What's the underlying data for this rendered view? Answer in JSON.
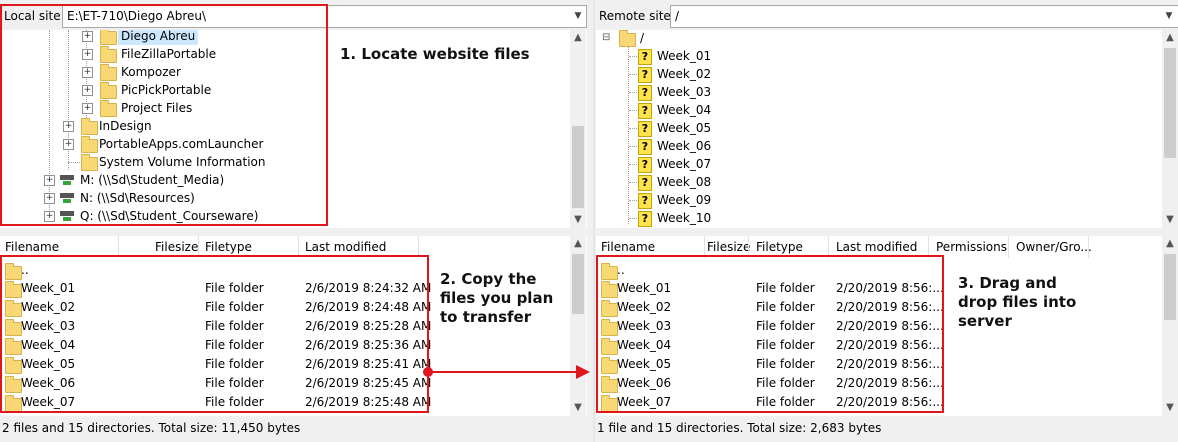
{
  "local": {
    "site_label": "Local site:",
    "path": "E:\\ET-710\\Diego Abreu\\",
    "tree": [
      {
        "label": "Diego Abreu",
        "selected": true
      },
      {
        "label": "FileZillaPortable"
      },
      {
        "label": "Kompozer"
      },
      {
        "label": "PicPickPortable"
      },
      {
        "label": "Project Files"
      },
      {
        "label": "InDesign"
      },
      {
        "label": "PortableApps.comLauncher"
      },
      {
        "label": "System Volume Information"
      },
      {
        "label": "M: (\\\\Sd\\Student_Media)"
      },
      {
        "label": "N: (\\\\Sd\\Resources)"
      },
      {
        "label": "Q: (\\\\Sd\\Student_Courseware)"
      }
    ],
    "columns": [
      "Filename",
      "Filesize",
      "Filetype",
      "Last modified"
    ],
    "rows": [
      {
        "name": "..",
        "type": "",
        "modified": ""
      },
      {
        "name": "Week_01",
        "type": "File folder",
        "modified": "2/6/2019 8:24:32 AM"
      },
      {
        "name": "Week_02",
        "type": "File folder",
        "modified": "2/6/2019 8:24:48 AM"
      },
      {
        "name": "Week_03",
        "type": "File folder",
        "modified": "2/6/2019 8:25:28 AM"
      },
      {
        "name": "Week_04",
        "type": "File folder",
        "modified": "2/6/2019 8:25:36 AM"
      },
      {
        "name": "Week_05",
        "type": "File folder",
        "modified": "2/6/2019 8:25:41 AM"
      },
      {
        "name": "Week_06",
        "type": "File folder",
        "modified": "2/6/2019 8:25:45 AM"
      },
      {
        "name": "Week_07",
        "type": "File folder",
        "modified": "2/6/2019 8:25:48 AM"
      }
    ],
    "status": "2 files and 15 directories. Total size: 11,450 bytes"
  },
  "remote": {
    "site_label": "Remote site:",
    "path": "/",
    "tree_root": "/",
    "tree": [
      "Week_01",
      "Week_02",
      "Week_03",
      "Week_04",
      "Week_05",
      "Week_06",
      "Week_07",
      "Week_08",
      "Week_09",
      "Week_10"
    ],
    "columns": [
      "Filename",
      "Filesize",
      "Filetype",
      "Last modified",
      "Permissions",
      "Owner/Gro..."
    ],
    "rows": [
      {
        "name": "..",
        "type": "",
        "modified": ""
      },
      {
        "name": "Week_01",
        "type": "File folder",
        "modified": "2/20/2019 8:56:..."
      },
      {
        "name": "Week_02",
        "type": "File folder",
        "modified": "2/20/2019 8:56:..."
      },
      {
        "name": "Week_03",
        "type": "File folder",
        "modified": "2/20/2019 8:56:..."
      },
      {
        "name": "Week_04",
        "type": "File folder",
        "modified": "2/20/2019 8:56:..."
      },
      {
        "name": "Week_05",
        "type": "File folder",
        "modified": "2/20/2019 8:56:..."
      },
      {
        "name": "Week_06",
        "type": "File folder",
        "modified": "2/20/2019 8:56:..."
      },
      {
        "name": "Week_07",
        "type": "File folder",
        "modified": "2/20/2019 8:56:..."
      }
    ],
    "status": "1 file and 15 directories. Total size: 2,683 bytes"
  },
  "annotations": {
    "step1": "1. Locate website files",
    "step2_lines": [
      "2. Copy the",
      "files you plan",
      "to transfer"
    ],
    "step3_lines": [
      "3. Drag and",
      "drop files into",
      "server"
    ]
  },
  "colors": {
    "highlight": "#e0161f",
    "folder": "#f8d775",
    "selected_row": "#cce8ff"
  }
}
